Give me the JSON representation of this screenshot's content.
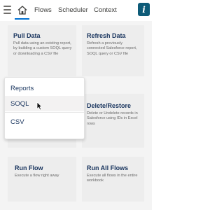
{
  "nav": {
    "menu_icon": "hamburger-icon",
    "home_icon": "home-icon",
    "tabs": [
      "Flows",
      "Scheduler",
      "Context"
    ],
    "info_label": "i",
    "accent": "#0070d2",
    "info_color": "#0e5b78"
  },
  "cards": {
    "pull": {
      "title": "Pull Data",
      "desc": "Pull data using an existing report, by building a custom SOQL query or downloading a CSV file"
    },
    "refresh": {
      "title": "Refresh Data",
      "desc": "Refresh a previously connected Salesforce report, SOQL query or CSV file"
    },
    "delete": {
      "title": "Delete/Restore",
      "desc": "Delete or Undelete records in Salesforce using IDs in Excel rows"
    },
    "run_flow": {
      "title": "Run Flow",
      "desc": "Execute a flow right away"
    },
    "run_all": {
      "title": "Run All Flows",
      "desc": "Execute all flows in the entire workbook"
    }
  },
  "dropdown": {
    "items": [
      "Reports",
      "SOQL",
      "CSV"
    ],
    "hovered": "SOQL"
  },
  "cursor_icon": "mouse-pointer-icon"
}
